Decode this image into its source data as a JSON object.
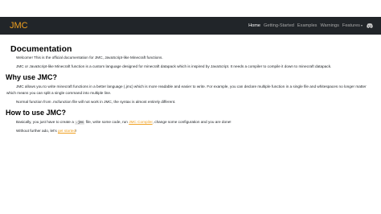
{
  "navbar": {
    "brand": "JMC",
    "links": [
      "Home",
      "Getting-Started",
      "Examples",
      "Warnings",
      "Features"
    ],
    "features_caret": "▾"
  },
  "content": {
    "title": "Documentation",
    "welcome": "Welcome! This is the official documentation for JMC, JavaScript-like Minecraft functions.",
    "intro": "JMC or JavaScript-like Minecraft function is a custom language designed for minecraft datapack which is inspired by JavaScript. It needs a compiler to compile it down to minecraft datapack.",
    "why_heading": "Why use JMC?",
    "why_p1": "JMC allows you to write minecraft functions in a better language (.jmc) which is more readable and easier to write. For example, you can declare multiple function in a single file and whitespaces no longer matter which means you can split a single command into multiple line.",
    "why_p2": "Normal function from .mcfunction file will not work in JMC, the syntax is almost entirely different.",
    "how_heading": "How to use JMC?",
    "how_p1_a": "Basically, you just have to create a ",
    "how_p1_code": ".jmc",
    "how_p1_b": " file, write some code, run ",
    "how_p1_link": "JMC Compiler",
    "how_p1_c": ", change some configuration and you are done!",
    "how_p2_a": "Without further ado, let's ",
    "how_p2_link": "get started",
    "how_p2_b": "!"
  },
  "colors": {
    "navbar_bg": "#212529",
    "accent": "#f0a020",
    "icons": [
      "discord-icon"
    ]
  }
}
